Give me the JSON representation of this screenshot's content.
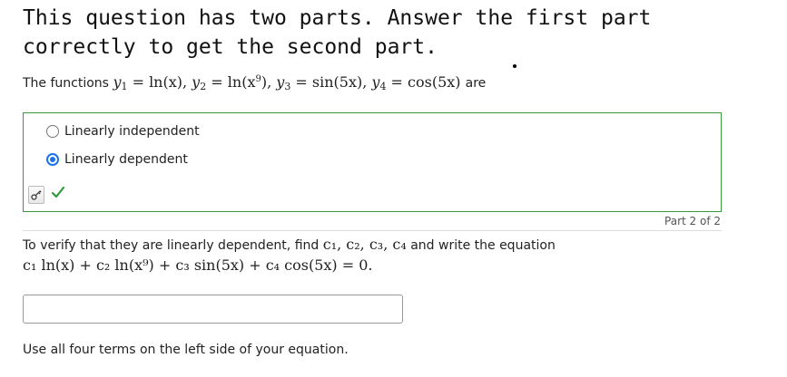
{
  "question": {
    "title": "This question has two parts. Answer the first part correctly to get the second part.",
    "intro_prefix": "The functions",
    "functions": {
      "y1_func": "ln(x)",
      "y2_func_base": "ln(x",
      "y2_exponent": "9",
      "y2_func_close": ")",
      "y3_func": "sin(5x)",
      "y4_func": "cos(5x)"
    },
    "intro_suffix": "are"
  },
  "part1": {
    "options": [
      {
        "label": "Linearly independent",
        "selected": false
      },
      {
        "label": "Linearly dependent",
        "selected": true
      }
    ],
    "status": "correct",
    "status_color": "#2e9b3a",
    "border_color": "#3a9a3a"
  },
  "part2": {
    "part_label": "Part 2 of 2",
    "instruction_prefix": "To verify that they are linearly dependent, find",
    "constants": "c₁, c₂, c₃, c₄",
    "instruction_suffix": "and write the equation",
    "equation": "c₁ ln(x) + c₂ ln(x⁹) + c₃ sin(5x) + c₄ cos(5x) = 0.",
    "input_value": "",
    "note": "Use all four terms on the left side of your equation."
  }
}
